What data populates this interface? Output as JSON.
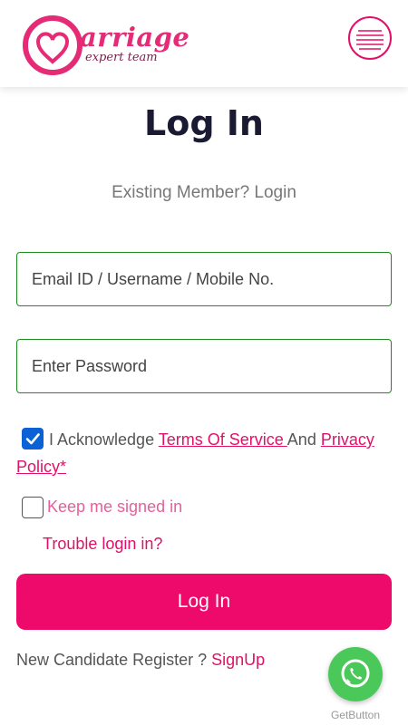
{
  "header": {
    "logo_word": "arriage",
    "logo_tagline": "expert team",
    "menu_icon": "hamburger-icon"
  },
  "page": {
    "title": "Log In",
    "subtitle": "Existing Member? Login"
  },
  "form": {
    "email_placeholder": "Email ID / Username / Mobile No.",
    "email_value": "",
    "password_placeholder": "Enter Password",
    "password_value": "",
    "ack_prefix": "I Acknowledge ",
    "ack_terms": "Terms Of Service ",
    "ack_and": "And ",
    "ack_privacy": "Privacy Policy*",
    "ack_checked": true,
    "keep_signed_in": "Keep me signed in",
    "keep_checked": false,
    "trouble_link": "Trouble login in?",
    "login_button": "Log In",
    "register_prefix": "New Candidate Register ? ",
    "register_link": "SignUp"
  },
  "widget": {
    "icon": "whatsapp-icon",
    "label": "GetButton"
  },
  "colors": {
    "brand_pink": "#ee0a6b",
    "field_border": "#1f8a1f",
    "checkbox_blue": "#0b62d6",
    "whatsapp_green": "#4bc85a"
  }
}
